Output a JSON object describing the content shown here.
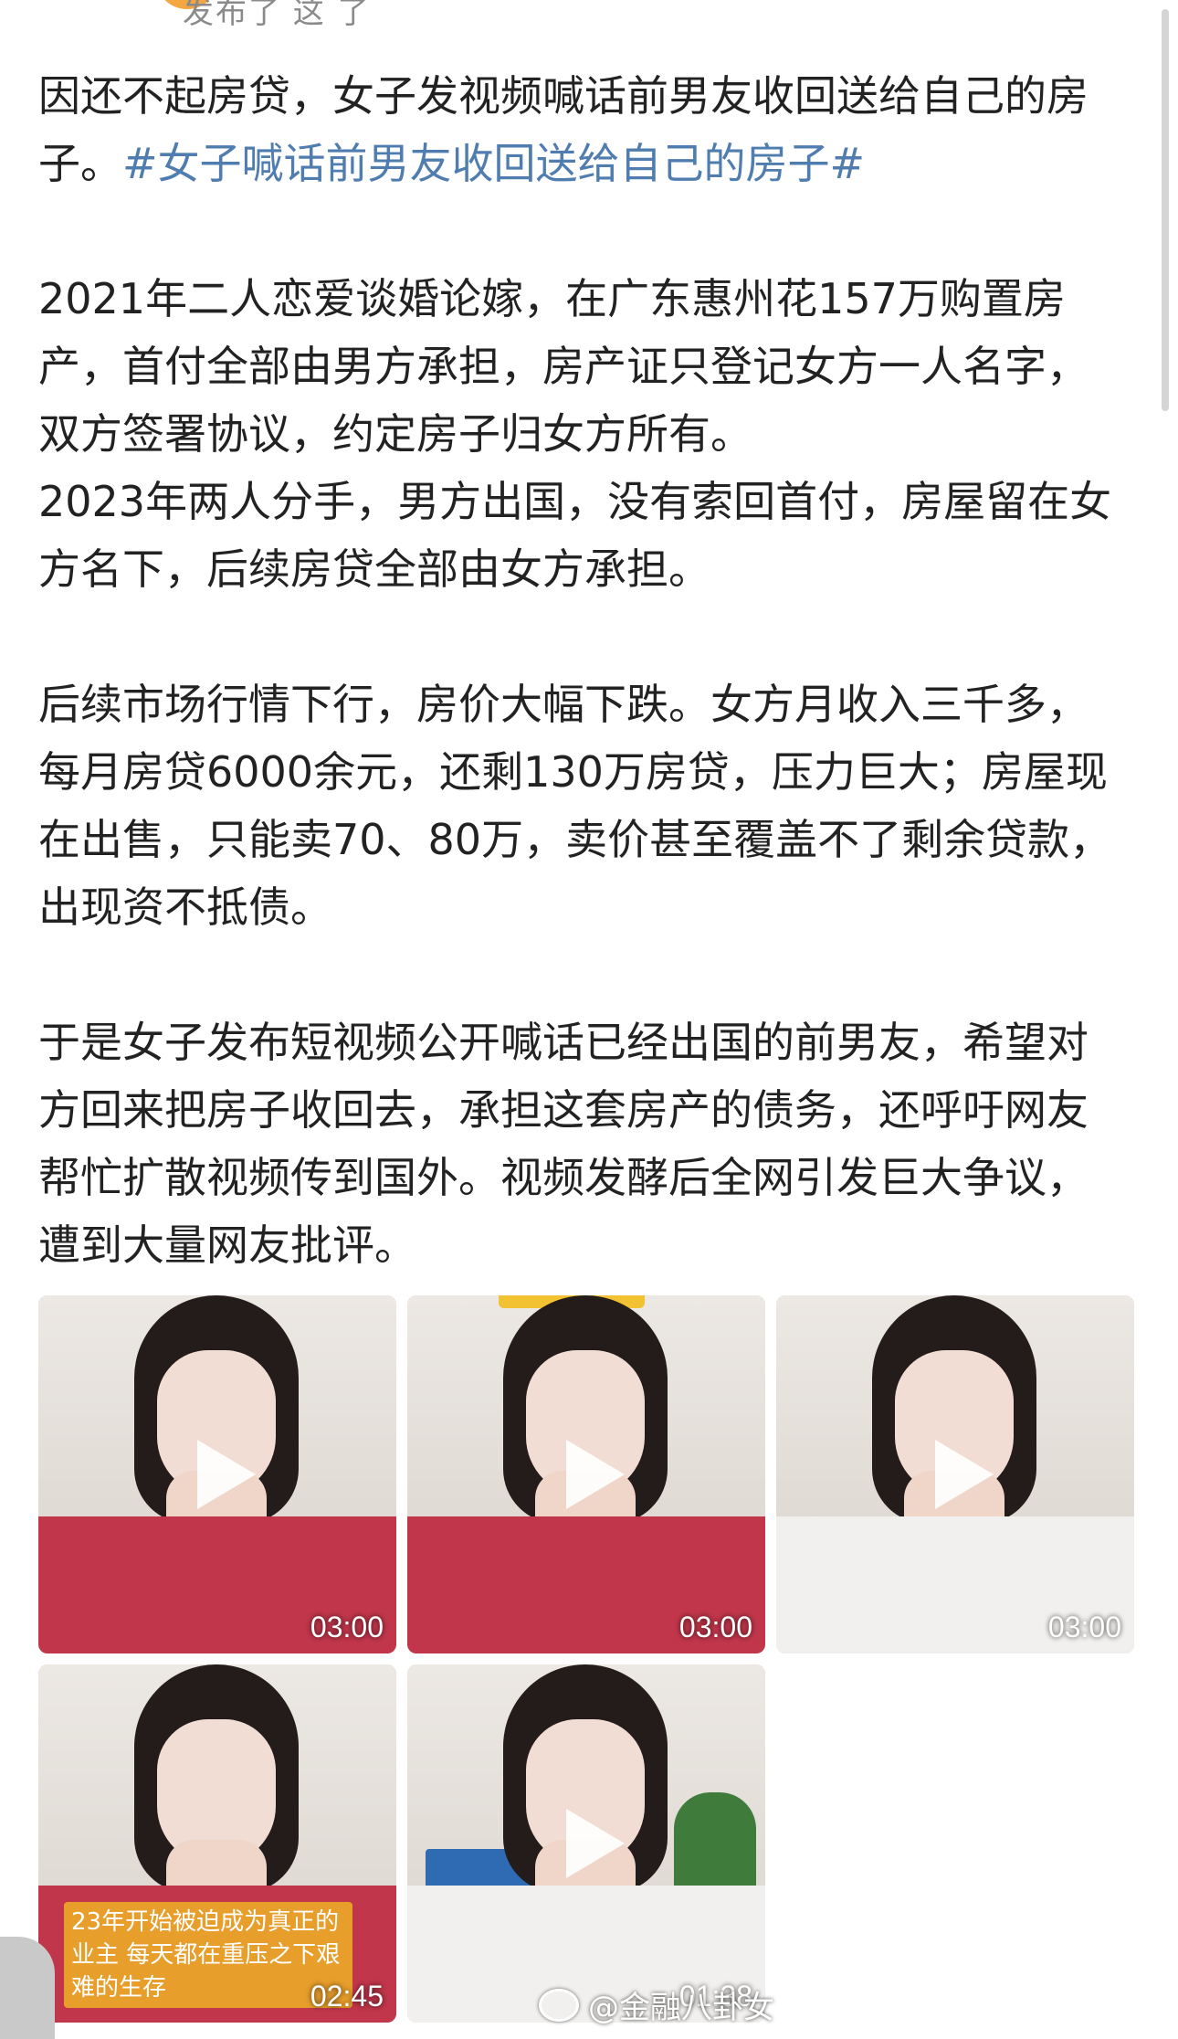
{
  "header": {
    "meta_text": "发布了 这 了"
  },
  "post": {
    "p1_text": "因还不起房贷，女子发视频喊话前男友收回送给自己的房子。",
    "p1_hashtag": "#女子喊话前男友收回送给自己的房子#",
    "p2": "2021年二人恋爱谈婚论嫁，在广东惠州花157万购置房产，首付全部由男方承担，房产证只登记女方一人名字，双方签署协议，约定房子归女方所有。",
    "p3": "2023年两人分手，男方出国，没有索回首付，房屋留在女方名下，后续房贷全部由女方承担。",
    "p4": "后续市场行情下行，房价大幅下跌。女方月收入三千多，每月房贷6000余元，还剩130万房贷，压力巨大；房屋现在出售，只能卖70、80万，卖价甚至覆盖不了剩余贷款，出现资不抵债。",
    "p5": "于是女子发布短视频公开喊话已经出国的前男友，希望对方回来把房子收回去，承担这套房产的债务，还呼吁网友帮忙扩散视频传到国外。视频发酵后全网引发巨大争议，遭到大量网友批评。"
  },
  "videos": [
    {
      "duration": "03:00"
    },
    {
      "duration": "03:00"
    },
    {
      "duration": "03:00"
    },
    {
      "duration": "02:45",
      "caption": "23年开始被迫成为真正的业主 每天都在重压之下艰难的生存"
    },
    {
      "duration": "01:38"
    }
  ],
  "watermark": {
    "text": "@金融八卦女"
  },
  "colors": {
    "hashtag": "#507daf",
    "text": "#222222"
  }
}
